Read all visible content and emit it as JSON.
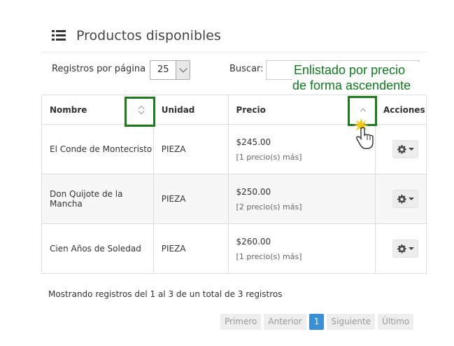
{
  "panel": {
    "title": "Productos disponibles",
    "icon": "list-icon"
  },
  "controls": {
    "length_label": "Registros por página",
    "length_value": "25",
    "search_label": "Buscar:",
    "search_value": ""
  },
  "annotation": {
    "line1": "Enlistado por precio",
    "line2": "de forma ascendente",
    "color": "#0f7a1e"
  },
  "table": {
    "headers": {
      "nombre": "Nombre",
      "unidad": "Unidad",
      "precio": "Precio",
      "acciones": "Acciones"
    },
    "rows": [
      {
        "nombre": "El Conde de Montecristo",
        "unidad": "PIEZA",
        "precio": "$245.00",
        "mas": "[1 precio(s) más]"
      },
      {
        "nombre": "Don Quijote de la Mancha",
        "unidad": "PIEZA",
        "precio": "$250.00",
        "mas": "[2 precio(s) más]"
      },
      {
        "nombre": "Cien Años de Soledad",
        "unidad": "PIEZA",
        "precio": "$260.00",
        "mas": "[1 precio(s) más]"
      }
    ]
  },
  "info": "Mostrando registros del 1 al 3 de un total de 3 registros",
  "pagination": {
    "first": "Primero",
    "prev": "Anterior",
    "current": "1",
    "next": "Siguiente",
    "last": "Último",
    "active_color": "#3a8fd6"
  }
}
